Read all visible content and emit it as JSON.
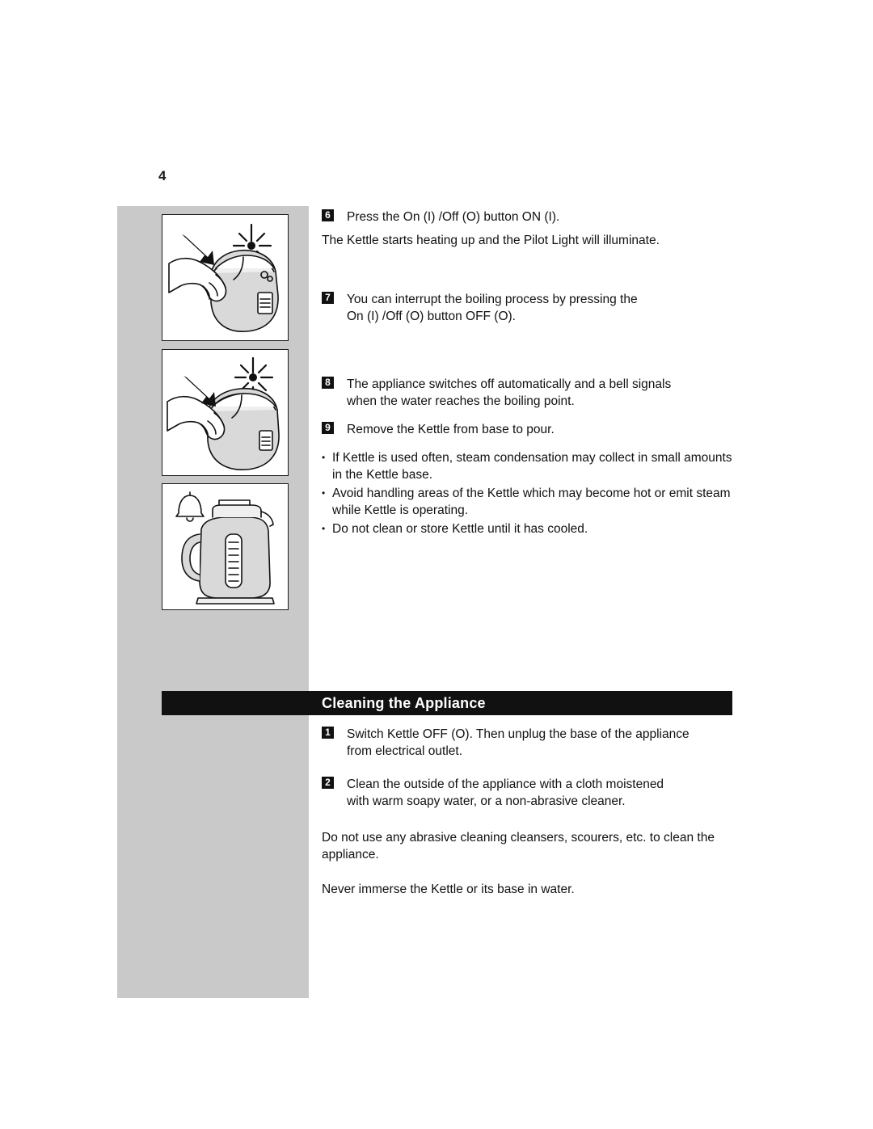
{
  "page": {
    "number": "4"
  },
  "steps": [
    {
      "num": "6",
      "lines": [
        "Press the On (I) /Off (O) button ON (I)."
      ]
    },
    {
      "num": "7",
      "lines": [
        "You can interrupt the boiling process by pressing the",
        "On (I) /Off (O) button OFF (O)."
      ]
    },
    {
      "num": "8",
      "lines": [
        "The appliance switches off automatically and a bell signals",
        "when the water reaches the boiling point."
      ]
    },
    {
      "num": "9",
      "lines": [
        "Remove the Kettle from base to pour."
      ]
    }
  ],
  "notes": {
    "after_step_6": "The Kettle starts heating up and the Pilot Light will illuminate."
  },
  "bullets": [
    "If Kettle is used often, steam condensation may collect in small amounts in the Kettle base.",
    "Avoid handling areas of the Kettle which may become hot or emit steam while Kettle is operating.",
    "Do not clean or store Kettle until it has cooled."
  ],
  "section": {
    "title": "Cleaning the Appliance",
    "steps": [
      {
        "num": "1",
        "lines": [
          "Switch Kettle OFF (O). Then unplug the base of the appliance",
          "from electrical outlet."
        ]
      },
      {
        "num": "2",
        "lines": [
          "Clean the outside of the appliance with a cloth moistened",
          "with warm soapy water, or a non-abrasive cleaner."
        ]
      }
    ],
    "paragraphs": [
      "Do not use any abrasive cleaning cleansers, scourers, etc. to clean the appliance.",
      "Never immerse the Kettle or its base in water."
    ]
  },
  "illustrations": [
    {
      "name": "kettle-switch-on-press",
      "caption": "Hand pressing On/Off button with flash burst"
    },
    {
      "name": "kettle-switch-off-press",
      "caption": "Hand pressing On/Off button to switch off with flash burst"
    },
    {
      "name": "kettle-bell-auto-off",
      "caption": "Kettle with bell icon indicating automatic shut-off"
    }
  ],
  "colors": {
    "band": "#c9c9c9",
    "bar": "#111111",
    "text": "#111111",
    "bar_text": "#ffffff"
  }
}
